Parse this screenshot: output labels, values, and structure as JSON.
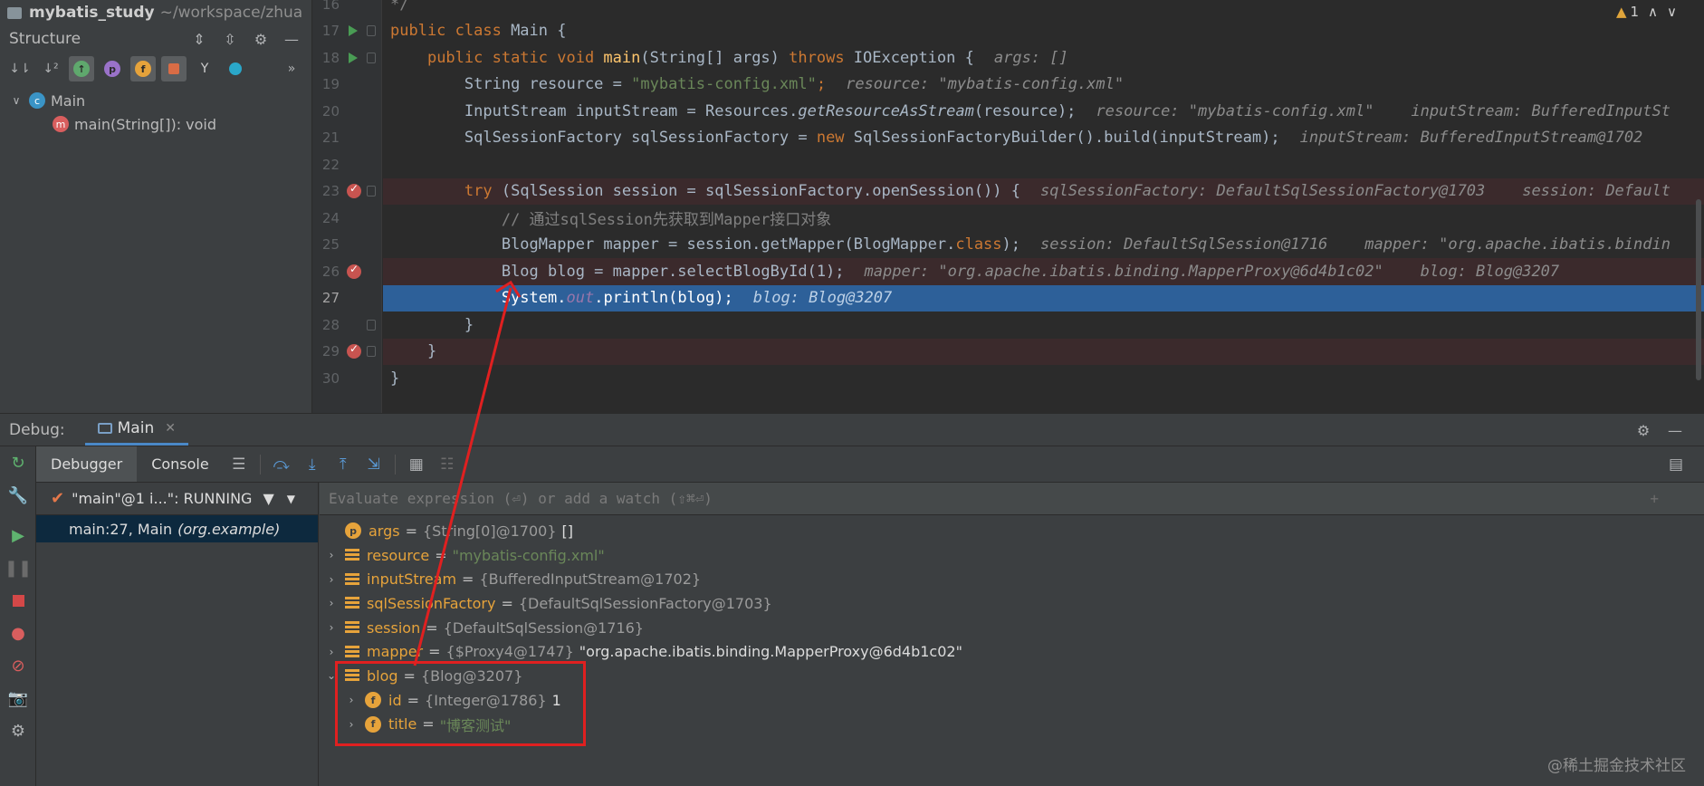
{
  "project": {
    "name": "mybatis_study",
    "path": "~/workspace/zhua"
  },
  "structure": {
    "title": "Structure",
    "tree": [
      {
        "label": "Main",
        "badge": "c"
      },
      {
        "label": "main(String[]): void",
        "badge": "m"
      }
    ]
  },
  "editor": {
    "warnings": "1",
    "gutter": [
      "16",
      "17",
      "18",
      "19",
      "20",
      "21",
      "22",
      "23",
      "24",
      "25",
      "26",
      "27",
      "28",
      "29",
      "30"
    ],
    "lines": {
      "l16": "*/",
      "l17_kw": "public class",
      "l17_rest": " Main {",
      "l18_kw1": "public static void",
      "l18_meth": " main",
      "l18_rest": "(String[] args) ",
      "l18_kw2": "throws",
      "l18_rest2": " IOException {",
      "l18_hint": "args: []",
      "l19_code": "String resource = ",
      "l19_str": "\"mybatis-config.xml\"",
      "l19_semi": ";",
      "l19_hint": "resource: \"mybatis-config.xml\"",
      "l20_code1": "InputStream inputStream = Resources.",
      "l20_it": "getResourceAsStream",
      "l20_code2": "(resource);",
      "l20_hint": "resource: \"mybatis-config.xml\"    inputStream: BufferedInputSt",
      "l21_code1": "SqlSessionFactory sqlSessionFactory = ",
      "l21_kw": "new",
      "l21_code2": " SqlSessionFactoryBuilder().build(inputStream);",
      "l21_hint": "inputStream: BufferedInputStream@1702",
      "l23_kw": "try",
      "l23_code": " (SqlSession session = sqlSessionFactory.openSession()) {",
      "l23_hint": "sqlSessionFactory: DefaultSqlSessionFactory@1703    session: Default",
      "l24_cmt": "// 通过sqlSession先获取到Mapper接口对象",
      "l25_code1": "BlogMapper mapper = session.getMapper(BlogMapper.",
      "l25_kw": "class",
      "l25_code2": ");",
      "l25_hint": "session: DefaultSqlSession@1716    mapper: \"org.apache.ibatis.bindin",
      "l26_code": "Blog blog = mapper.selectBlogById(1);",
      "l26_hint": "mapper: \"org.apache.ibatis.binding.MapperProxy@6d4b1c02\"    blog: Blog@3207",
      "l27_code1": "System.",
      "l27_it": "out",
      "l27_code2": ".println(blog);",
      "l27_hint": "blog: Blog@3207",
      "l28": "}",
      "l29": "}",
      "l30": "}"
    }
  },
  "debug": {
    "title": "Debug:",
    "tab": "Main",
    "tabs": [
      "Debugger",
      "Console"
    ],
    "thread": "\"main\"@1 i...\": RUNNING",
    "frame": "main:27, Main",
    "frame_pkg": "(org.example)",
    "watch_placeholder": "Evaluate expression (⏎) or add a watch (⇧⌘⏎)",
    "variables": [
      {
        "name": "args",
        "type": "{String[0]@1700}",
        "value": "[]"
      },
      {
        "name": "resource",
        "str": "\"mybatis-config.xml\""
      },
      {
        "name": "inputStream",
        "type": "{BufferedInputStream@1702}"
      },
      {
        "name": "sqlSessionFactory",
        "type": "{DefaultSqlSessionFactory@1703}"
      },
      {
        "name": "session",
        "type": "{DefaultSqlSession@1716}"
      },
      {
        "name": "mapper",
        "type": "{$Proxy4@1747}",
        "value": "\"org.apache.ibatis.binding.MapperProxy@6d4b1c02\""
      },
      {
        "name": "blog",
        "type": "{Blog@3207}"
      },
      {
        "name": "id",
        "type": "{Integer@1786}",
        "value": "1"
      },
      {
        "name": "title",
        "str": "\"博客测试\""
      }
    ]
  },
  "watermark": "@稀土掘金技术社区",
  "colors": {
    "accent": "#2d6099",
    "breakpoint": "#c75450",
    "annotation": "#e02020"
  }
}
